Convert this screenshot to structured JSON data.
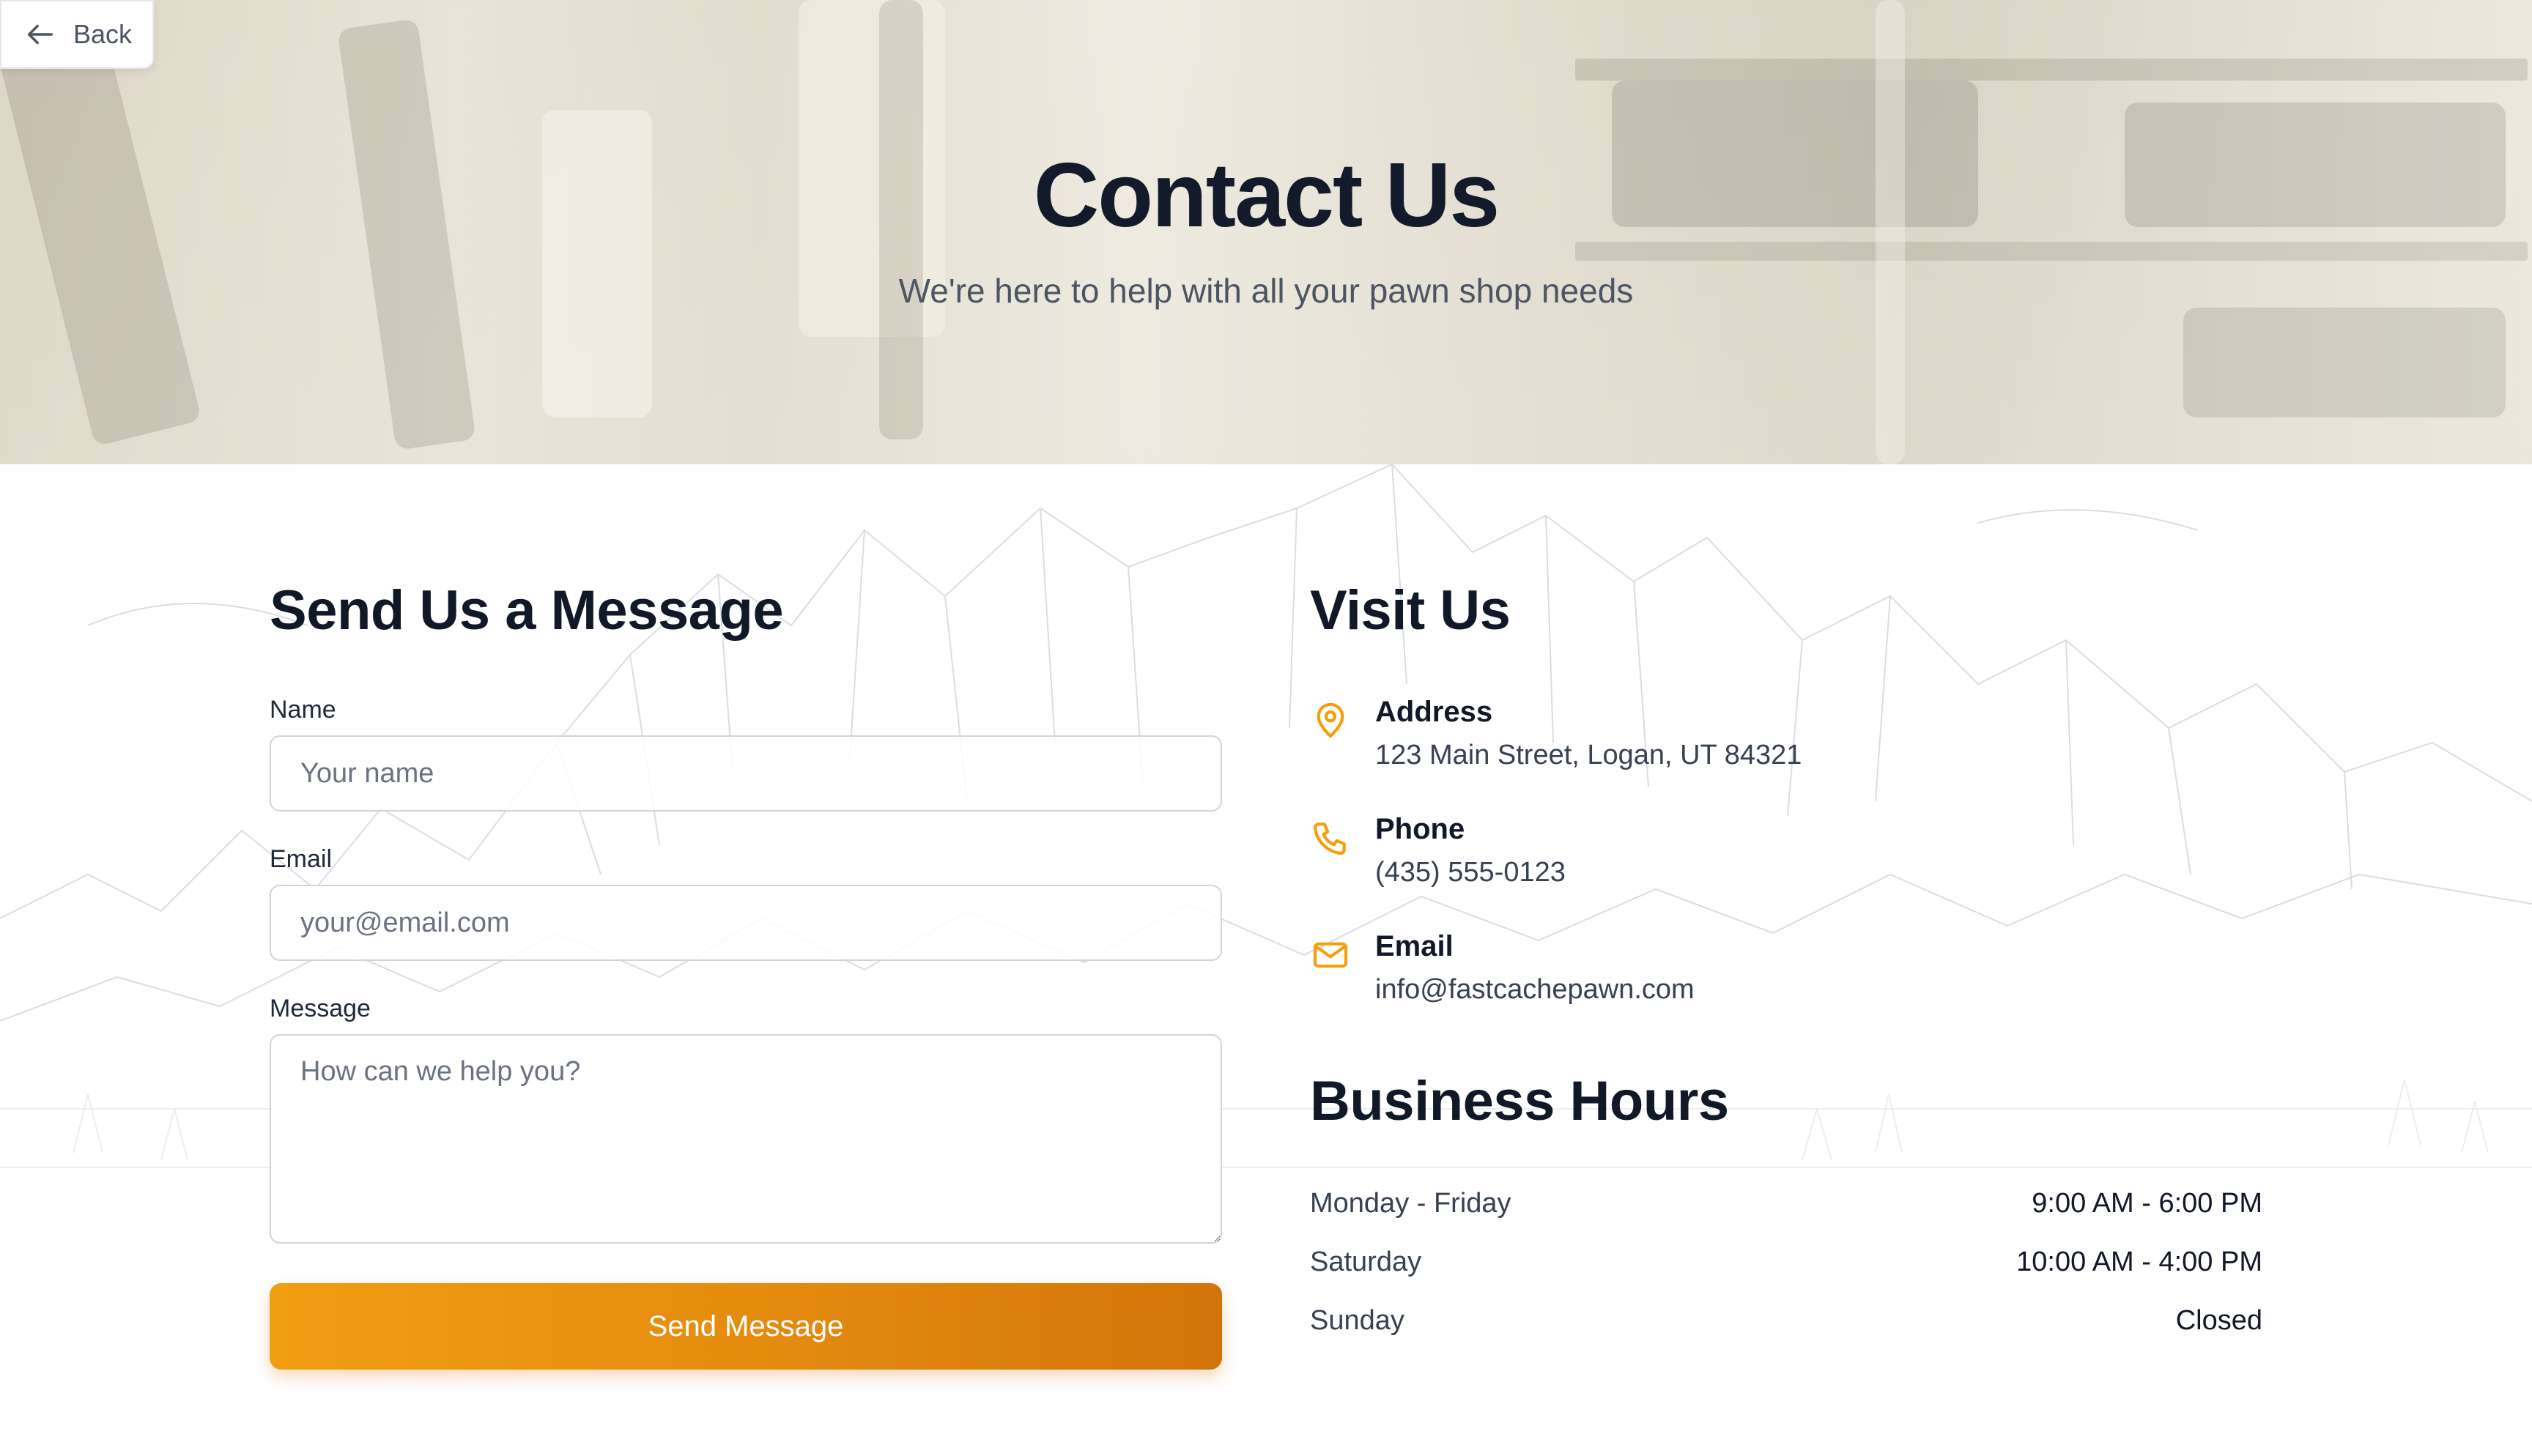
{
  "back": {
    "label": "Back",
    "icon": "arrow-left-icon"
  },
  "hero": {
    "title": "Contact Us",
    "subtitle": "We're here to help with all your pawn shop needs"
  },
  "form": {
    "title": "Send Us a Message",
    "name_label": "Name",
    "name_placeholder": "Your name",
    "email_label": "Email",
    "email_placeholder": "your@email.com",
    "message_label": "Message",
    "message_placeholder": "How can we help you?",
    "submit_label": "Send Message"
  },
  "visit": {
    "title": "Visit Us",
    "items": [
      {
        "icon": "map-pin-icon",
        "title": "Address",
        "value": "123 Main Street, Logan, UT 84321"
      },
      {
        "icon": "phone-icon",
        "title": "Phone",
        "value": "(435) 555-0123"
      },
      {
        "icon": "mail-icon",
        "title": "Email",
        "value": "info@fastcachepawn.com"
      }
    ]
  },
  "hours": {
    "title": "Business Hours",
    "rows": [
      {
        "day": "Monday - Friday",
        "time": "9:00 AM - 6:00 PM"
      },
      {
        "day": "Saturday",
        "time": "10:00 AM - 4:00 PM"
      },
      {
        "day": "Sunday",
        "time": "Closed"
      }
    ]
  },
  "colors": {
    "accent": "#f59e0b",
    "button_gradient_start": "#f09e12",
    "button_gradient_end": "#d2740a",
    "heading": "#111827"
  }
}
